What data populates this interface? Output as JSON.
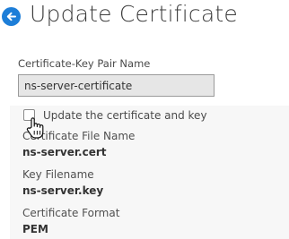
{
  "header": {
    "back_icon": "back-arrow-icon",
    "title": "Update Certificate",
    "accent_color": "#1d7ed8"
  },
  "form": {
    "cert_key_pair_label": "Certificate-Key Pair Name",
    "cert_key_pair_value": "ns-server-certificate",
    "update_checkbox_label": "Update the certificate and key",
    "update_checkbox_checked": false
  },
  "details": {
    "cert_file_label": "Certificate File Name",
    "cert_file_value": "ns-server.cert",
    "key_file_label": "Key Filename",
    "key_file_value": "ns-server.key",
    "cert_format_label": "Certificate Format",
    "cert_format_value": "PEM"
  }
}
